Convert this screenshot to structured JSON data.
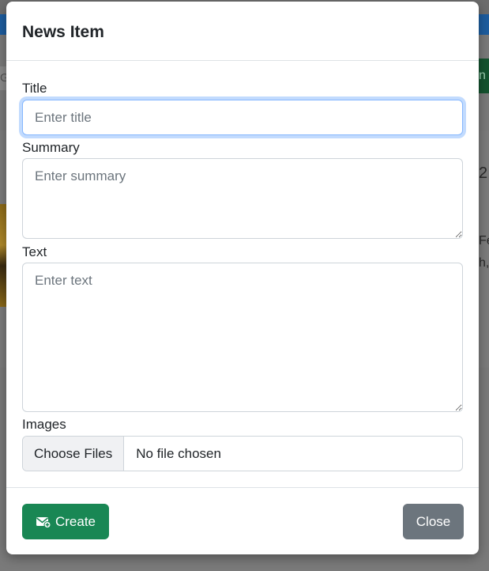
{
  "modal": {
    "title": "News Item"
  },
  "form": {
    "title_label": "Title",
    "title_placeholder": "Enter title",
    "summary_label": "Summary",
    "summary_placeholder": "Enter summary",
    "text_label": "Text",
    "text_placeholder": "Enter text",
    "images_label": "Images",
    "choose_files_label": "Choose Files",
    "file_status": "No file chosen"
  },
  "footer": {
    "create_label": "Create",
    "close_label": "Close"
  },
  "background": {
    "right_text_1": "2",
    "right_text_2": "Fe",
    "right_text_3": "h,",
    "green_button_glyph": "n",
    "left_input_glyph": "G"
  },
  "colors": {
    "primary_green": "#198754",
    "secondary_gray": "#6c757d",
    "focus_border": "#86b7fe"
  },
  "icons": {
    "create_icon": "envelope-plus-icon"
  }
}
